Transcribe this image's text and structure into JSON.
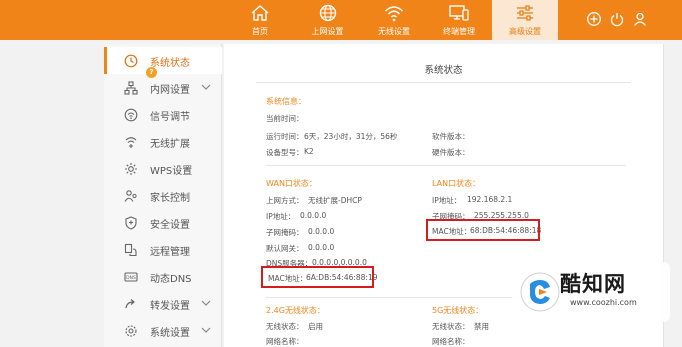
{
  "nav": {
    "items": [
      {
        "label": "首页",
        "icon": "home-icon"
      },
      {
        "label": "上网设置",
        "icon": "globe-icon"
      },
      {
        "label": "无线设置",
        "icon": "wifi-icon"
      },
      {
        "label": "终端管理",
        "icon": "devices-icon"
      },
      {
        "label": "高级设置",
        "icon": "sliders-icon",
        "active": true
      }
    ],
    "right_icons": [
      "add-icon",
      "power-icon",
      "user-icon"
    ]
  },
  "sidebar": {
    "items": [
      {
        "label": "系统状态",
        "icon": "clock-icon",
        "active": true
      },
      {
        "label": "内网设置",
        "icon": "network-icon",
        "expandable": true
      },
      {
        "label": "信号调节",
        "icon": "signal-icon"
      },
      {
        "label": "无线扩展",
        "icon": "extend-icon"
      },
      {
        "label": "WPS设置",
        "icon": "wps-gear-icon"
      },
      {
        "label": "家长控制",
        "icon": "parental-icon"
      },
      {
        "label": "安全设置",
        "icon": "shield-icon"
      },
      {
        "label": "远程管理",
        "icon": "remote-icon"
      },
      {
        "label": "动态DNS",
        "icon": "dns-icon"
      },
      {
        "label": "转发设置",
        "icon": "forward-icon",
        "expandable": true
      },
      {
        "label": "系统设置",
        "icon": "settings-icon",
        "expandable": true
      }
    ]
  },
  "main": {
    "title": "系统状态",
    "system": {
      "heading": "系统信息：",
      "current_time_label": "当前时间：",
      "uptime_label": "运行时间：",
      "uptime_value": "6天，23小时，31分，56秒",
      "model_label": "设备型号：",
      "model_value": "K2",
      "software_label": "软件版本：",
      "hardware_label": "硬件版本："
    },
    "wan": {
      "heading": "WAN口状态：",
      "mode_label": "上网方式：",
      "mode_value": "无线扩展-DHCP",
      "ip_label": "IP地址：",
      "ip_value": "0.0.0.0",
      "mask_label": "子网掩码：",
      "mask_value": "0.0.0.0",
      "gateway_label": "默认网关：",
      "gateway_value": "0.0.0.0",
      "dns_label": "DNS服务器：",
      "dns_value": "0.0.0.0,0.0.0.0",
      "mac_label": "MAC地址：",
      "mac_value": "6A:DB:54:46:88:19"
    },
    "lan": {
      "heading": "LAN口状态：",
      "ip_label": "IP地址：",
      "ip_value": "192.168.2.1",
      "mask_label": "子网掩码：",
      "mask_value": "255.255.255.0",
      "mac_label": "MAC地址：",
      "mac_value": "68:DB:54:46:88:18"
    },
    "wifi24": {
      "heading": "2.4G无线状态：",
      "status_label": "无线状态：",
      "status_value": "启用",
      "name_label": "网络名称："
    },
    "wifi5": {
      "heading": "5G无线状态：",
      "status_label": "无线状态：",
      "status_value": "禁用",
      "name_label": "网络名称："
    }
  },
  "watermark": {
    "text": "酷知网",
    "url": "www.coozhi.com"
  },
  "colors": {
    "accent": "#f08419",
    "highlight_box": "#d21e1e",
    "active_tab_bg": "#fbe7d2"
  }
}
